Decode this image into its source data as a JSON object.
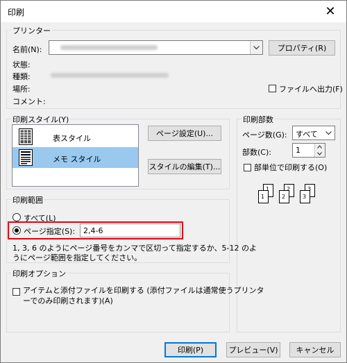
{
  "window": {
    "title": "印刷",
    "close_glyph": "✕"
  },
  "printer": {
    "group_label": "プリンター",
    "name_label": "名前(N):",
    "properties_button": "プロパティ(R)",
    "status_label": "状態:",
    "type_label": "種類:",
    "location_label": "場所:",
    "comment_label": "コメント:",
    "print_to_file_label": "ファイルへ出力(F)",
    "print_to_file_checked": false
  },
  "print_style": {
    "group_label": "印刷スタイル(Y)",
    "items": [
      {
        "label": "表スタイル",
        "icon": "table-style-icon",
        "selected": false
      },
      {
        "label": "メモ スタイル",
        "icon": "memo-style-icon",
        "selected": true
      }
    ],
    "page_setup_button": "ページ設定(U)...",
    "edit_style_button": "スタイルの編集(T)..."
  },
  "copies": {
    "group_label": "印刷部数",
    "pages_label": "ページ数(G):",
    "pages_value": "すべて",
    "copies_label": "部数(C):",
    "copies_value": "1",
    "collate_label": "部単位で印刷する(O)",
    "collate_checked": false,
    "collate_page_numbers": [
      "1",
      "1",
      "2",
      "2",
      "3",
      "3"
    ]
  },
  "range": {
    "group_label": "印刷範囲",
    "all_label": "すべて(L)",
    "pages_label": "ページ指定(S):",
    "pages_value": "2,4-6",
    "selected": "pages",
    "hint": "1, 3, 6 のようにページ番号をカンマで区切って指定するか、5-12 のよ",
    "hint_line2": "うにページ範囲を指定してください。"
  },
  "options": {
    "group_label": "印刷オプション",
    "attachments_label": "アイテムと添付ファイルを印刷する (添付ファイルは通常使うプリンタ",
    "attachments_label_line2": "ーでのみ印刷されます)(A)",
    "attachments_checked": false
  },
  "footer": {
    "print_button": "印刷(P)",
    "preview_button": "プレビュー(V)",
    "cancel_button": "キャンセル"
  },
  "colors": {
    "accent": "#0078d7",
    "highlight": "#e60012",
    "selection": "#99c9ef"
  }
}
